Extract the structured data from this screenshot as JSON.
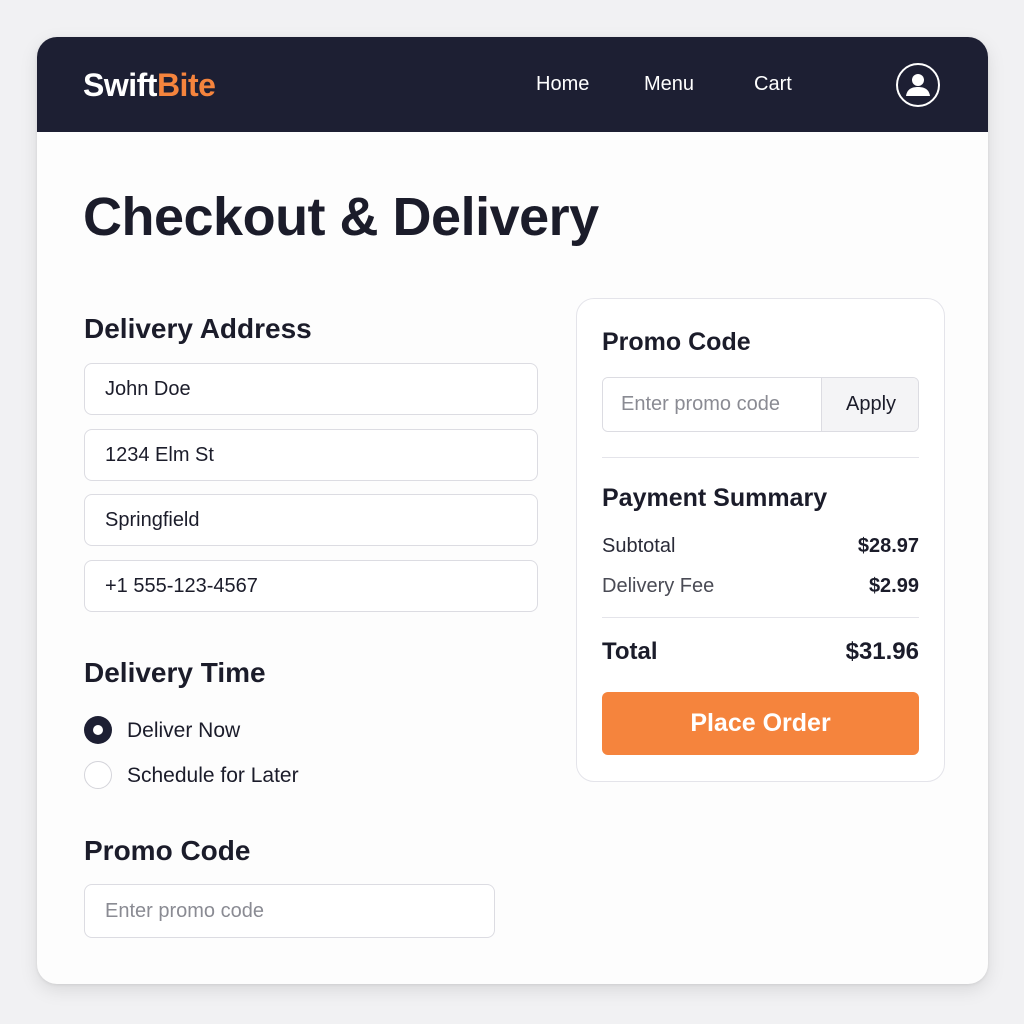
{
  "brand": {
    "name_part1": "Swift",
    "name_part2": "Bite",
    "accent_color": "#f5843d",
    "nav_color": "#1d1f33"
  },
  "nav": {
    "links": [
      {
        "label": "Home"
      },
      {
        "label": "Menu"
      },
      {
        "label": "Cart"
      }
    ],
    "account_icon": "user-avatar-icon"
  },
  "page": {
    "title": "Checkout & Delivery"
  },
  "delivery_address": {
    "heading": "Delivery Address",
    "fields": [
      {
        "value": "John Doe"
      },
      {
        "value": "1234 Elm St"
      },
      {
        "value": "Springfield"
      },
      {
        "value": "+1 555-123-4567"
      }
    ]
  },
  "delivery_time": {
    "heading": "Delivery Time",
    "options": [
      {
        "label": "Deliver Now",
        "selected": true
      },
      {
        "label": "Schedule for Later",
        "selected": false
      }
    ]
  },
  "promo_left": {
    "heading": "Promo Code",
    "placeholder": "Enter promo code"
  },
  "summary_card": {
    "promo": {
      "heading": "Promo Code",
      "placeholder": "Enter promo code",
      "apply_label": "Apply"
    },
    "payment": {
      "heading": "Payment Summary",
      "subtotal_label": "Subtotal",
      "subtotal_value": "$28.97",
      "fee_label": "Delivery Fee",
      "fee_value": "$2.99",
      "total_label": "Total",
      "total_value": "$31.96"
    },
    "place_order_label": "Place Order"
  }
}
